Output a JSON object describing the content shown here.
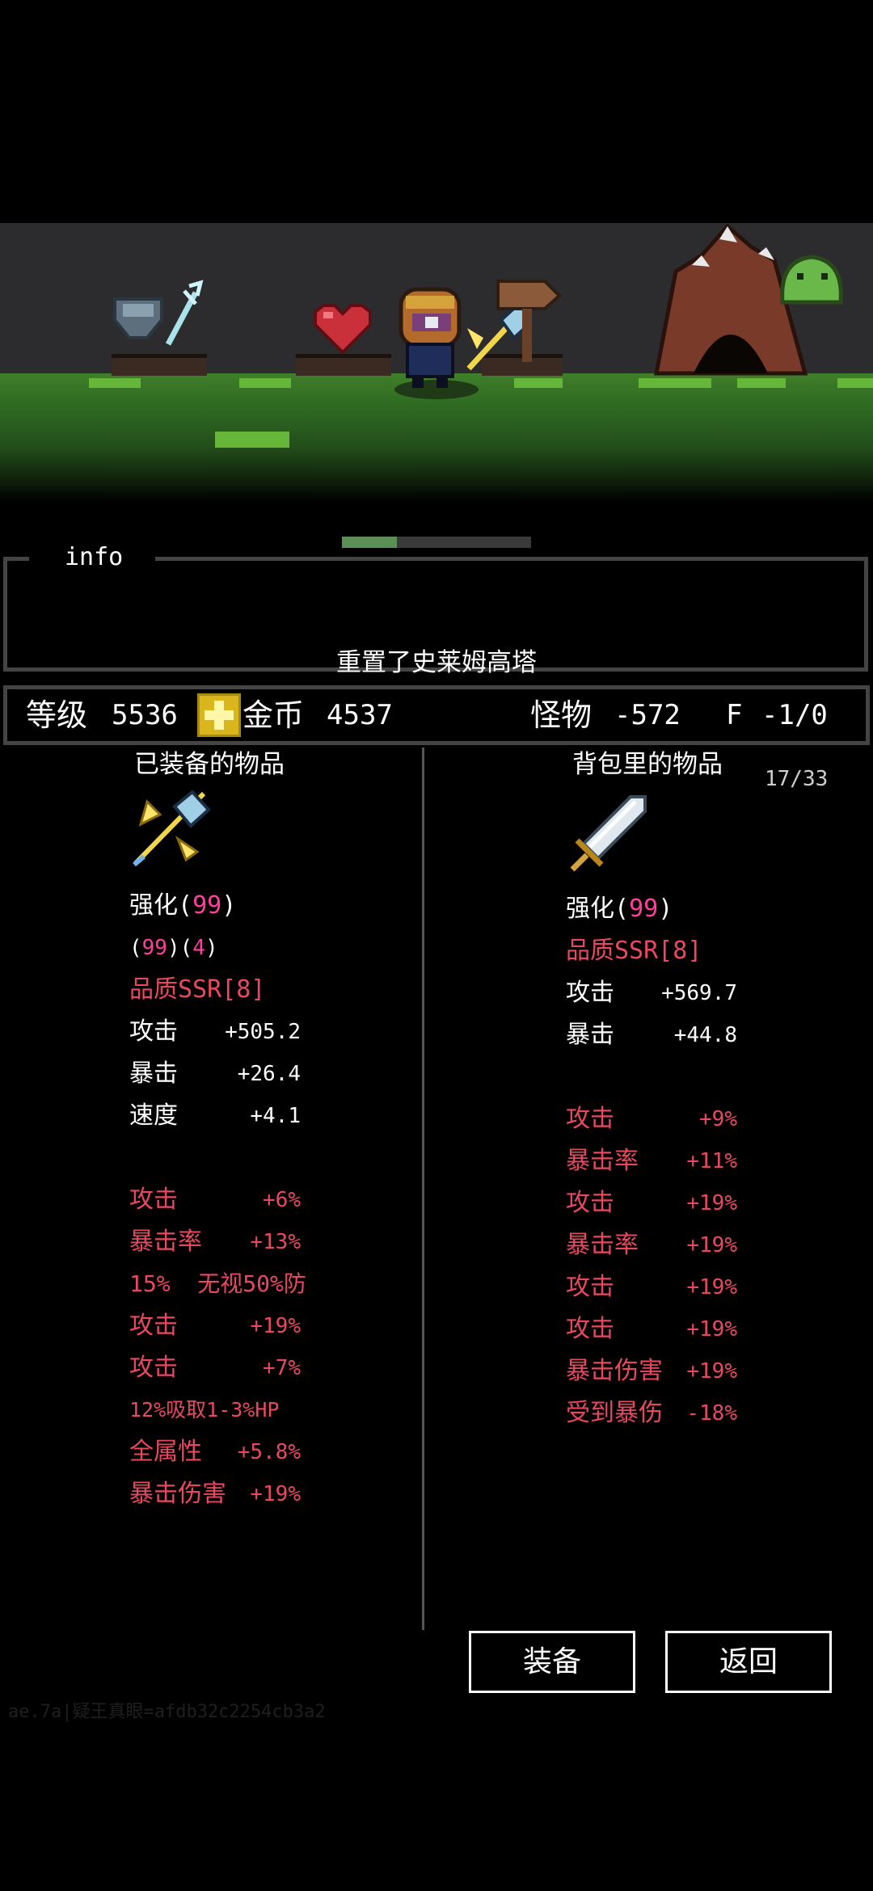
{
  "info": {
    "title": "info",
    "message": "重置了史莱姆高塔"
  },
  "progress": 0.29,
  "stats": {
    "level_label": "等级",
    "level_value": "5536",
    "gold_label": "金币",
    "gold_value": "4537",
    "monster_label": "怪物",
    "monster_value": "-572",
    "floor_label": "F",
    "floor_value": "-1/0"
  },
  "equipped": {
    "title": "已装备的物品",
    "icon": "golden-axe-icon",
    "enhance_label": "强化(",
    "enhance_value": "99",
    "enhance_close": ")",
    "sub_open": "(",
    "sub_value1": "99",
    "sub_mid": ")(",
    "sub_value2": "4",
    "sub_close": ")",
    "quality": "品质SSR[8]",
    "base_stats": [
      {
        "label": "攻击",
        "value": "+505.2"
      },
      {
        "label": "暴击",
        "value": "+26.4"
      },
      {
        "label": "速度",
        "value": "+4.1"
      }
    ],
    "bonus_stats": [
      {
        "label": "攻击",
        "value": "+6%"
      },
      {
        "label": "暴击率",
        "value": "+13%"
      },
      {
        "label": "15%  无视50%防",
        "value": ""
      },
      {
        "label": "攻击",
        "value": "+19%"
      },
      {
        "label": "攻击",
        "value": "+7%"
      },
      {
        "label": "12%吸取1-3%HP",
        "value": ""
      },
      {
        "label": "全属性",
        "value": "+5.8%"
      },
      {
        "label": "暴击伤害",
        "value": "+19%"
      }
    ]
  },
  "backpack": {
    "title": "背包里的物品",
    "count": "17/33",
    "icon": "silver-sword-icon",
    "enhance_label": "强化(",
    "enhance_value": "99",
    "enhance_close": ")",
    "quality": "品质SSR[8]",
    "base_stats": [
      {
        "label": "攻击",
        "value": "+569.7"
      },
      {
        "label": "暴击",
        "value": "+44.8"
      }
    ],
    "bonus_stats": [
      {
        "label": "攻击",
        "value": "+9%"
      },
      {
        "label": "暴击率",
        "value": "+11%"
      },
      {
        "label": "攻击",
        "value": "+19%"
      },
      {
        "label": "暴击率",
        "value": "+19%"
      },
      {
        "label": "攻击",
        "value": "+19%"
      },
      {
        "label": "攻击",
        "value": "+19%"
      },
      {
        "label": "暴击伤害",
        "value": "+19%"
      },
      {
        "label": "受到暴伤",
        "value": "-18%"
      }
    ]
  },
  "buttons": {
    "equip": "装备",
    "back": "返回"
  },
  "watermark": "ae.7a|疑王真眼=afdb32c2254cb3a2",
  "colors": {
    "red": "#e8495f",
    "pink": "#ff3f9e",
    "border": "#444444",
    "gold": "#d9b61e"
  }
}
